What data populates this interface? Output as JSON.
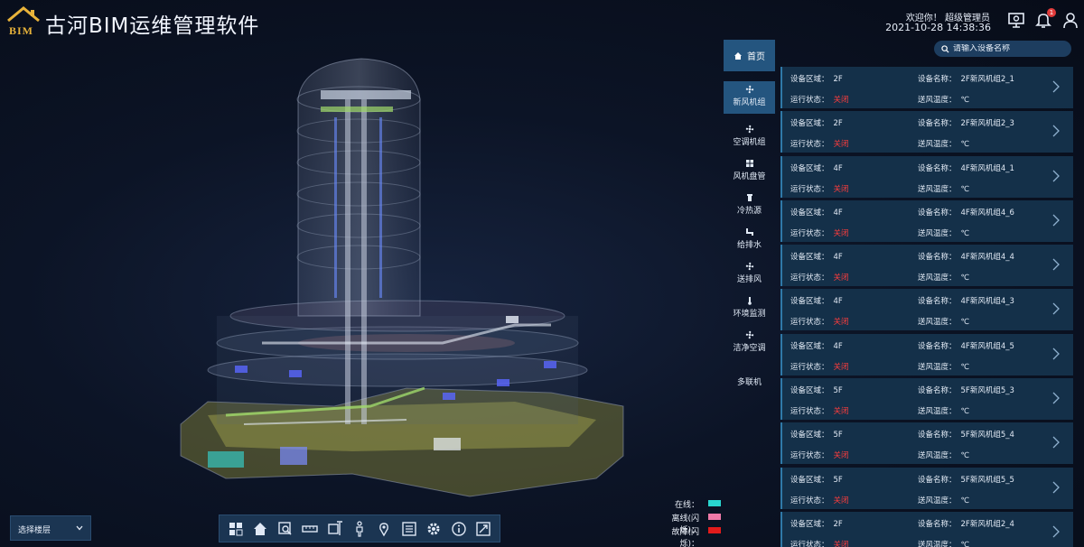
{
  "header": {
    "logo_text": "BIM",
    "title": "古河BIM运维管理软件",
    "welcome": "欢迎你！ 超级管理员",
    "datetime": "2021-10-28 14:38:36",
    "notification_count": "1"
  },
  "nav": {
    "home": "首页",
    "items": [
      {
        "label": "新风机组",
        "icon": "fan-icon"
      },
      {
        "label": "空调机组",
        "icon": "fan-icon"
      },
      {
        "label": "风机盘管",
        "icon": "grid-icon"
      },
      {
        "label": "冷热源",
        "icon": "chiller-icon"
      },
      {
        "label": "给排水",
        "icon": "pipe-icon"
      },
      {
        "label": "送排风",
        "icon": "fan-icon"
      },
      {
        "label": "环境监测",
        "icon": "thermometer-icon"
      },
      {
        "label": "洁净空调",
        "icon": "fan-icon"
      },
      {
        "label": "多联机",
        "icon": ""
      }
    ],
    "active_index": 0
  },
  "search": {
    "placeholder": "请输入设备名称"
  },
  "field_labels": {
    "area": "设备区域：",
    "name": "设备名称：",
    "status": "运行状态：",
    "temp": "送风温度："
  },
  "devices": [
    {
      "area": "2F",
      "name": "2F新风机组2_1",
      "status": "关闭",
      "temp": "℃"
    },
    {
      "area": "2F",
      "name": "2F新风机组2_3",
      "status": "关闭",
      "temp": "℃"
    },
    {
      "area": "4F",
      "name": "4F新风机组4_1",
      "status": "关闭",
      "temp": "℃"
    },
    {
      "area": "4F",
      "name": "4F新风机组4_6",
      "status": "关闭",
      "temp": "℃"
    },
    {
      "area": "4F",
      "name": "4F新风机组4_4",
      "status": "关闭",
      "temp": "℃"
    },
    {
      "area": "4F",
      "name": "4F新风机组4_3",
      "status": "关闭",
      "temp": "℃"
    },
    {
      "area": "4F",
      "name": "4F新风机组4_5",
      "status": "关闭",
      "temp": "℃"
    },
    {
      "area": "5F",
      "name": "5F新风机组5_3",
      "status": "关闭",
      "temp": "℃"
    },
    {
      "area": "5F",
      "name": "5F新风机组5_4",
      "status": "关闭",
      "temp": "℃"
    },
    {
      "area": "5F",
      "name": "5F新风机组5_5",
      "status": "关闭",
      "temp": "℃"
    },
    {
      "area": "2F",
      "name": "2F新风机组2_4",
      "status": "关闭",
      "temp": "℃"
    }
  ],
  "legend": [
    {
      "label": "在线：",
      "color": "#29d6cf"
    },
    {
      "label": "离线(闪烁)：",
      "color": "#f07aa8"
    },
    {
      "label": "故障(闪烁)：",
      "color": "#e21b1b"
    }
  ],
  "floor_select": {
    "value": "选择楼层"
  },
  "toolbar": [
    "grid-view-icon",
    "home-icon",
    "zoom-area-icon",
    "measure-icon",
    "section-icon",
    "person-roam-icon",
    "location-pin-icon",
    "properties-icon",
    "settings-icon",
    "info-icon",
    "fullscreen-icon"
  ]
}
